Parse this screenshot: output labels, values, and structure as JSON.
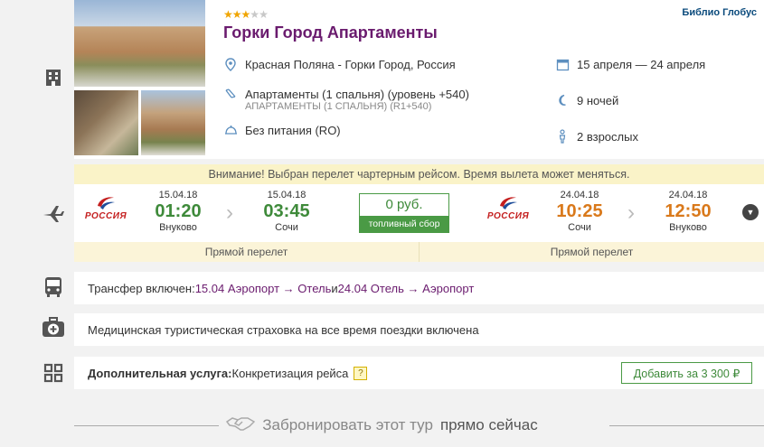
{
  "hotel": {
    "stars_total": 5,
    "stars_filled": 3,
    "operator": "Библио Глобус",
    "name": "Горки Город Апартаменты",
    "location": "Красная Поляна - Горки Город, Россия",
    "room": "Апартаменты (1 спальня) (уровень +540)",
    "room_sub": "АПАРТАМЕНТЫ (1 СПАЛЬНЯ) (R1+540)",
    "meal": "Без питания (RO)",
    "dates": "15 апреля — 24 апреля",
    "nights": "9 ночей",
    "guests": "2 взрослых"
  },
  "flight": {
    "notice": "Внимание! Выбран перелет чартерным рейсом. Время вылета может меняться.",
    "airline": "РОССИЯ",
    "outbound": {
      "dep_date": "15.04.18",
      "dep_time": "01:20",
      "dep_airport": "Внуково",
      "arr_date": "15.04.18",
      "arr_time": "03:45",
      "arr_airport": "Сочи",
      "type": "Прямой перелет"
    },
    "fuel": {
      "amount": "0 руб.",
      "label": "топливный сбор"
    },
    "inbound": {
      "dep_date": "24.04.18",
      "dep_time": "10:25",
      "dep_airport": "Сочи",
      "arr_date": "24.04.18",
      "arr_time": "12:50",
      "arr_airport": "Внуково",
      "type": "Прямой перелет"
    }
  },
  "transfer": {
    "prefix": "Трансфер включен: ",
    "leg1": "15.04 Аэропорт → Отель",
    "conj": " и ",
    "leg2": "24.04 Отель → Аэропорт"
  },
  "insurance": {
    "text": "Медицинская туристическая страховка на все время поездки включена"
  },
  "extra": {
    "label": "Дополнительная услуга:",
    "value": " Конкретизация рейса",
    "help": "?",
    "button": "Добавить за 3 300 ₽"
  },
  "footer": {
    "cta_main": "Забронировать этот тур",
    "cta_bold": "прямо сейчас"
  },
  "icons": [
    "hotel-icon",
    "plane-icon",
    "bus-icon",
    "medkit-icon",
    "grid-icon",
    "map-pin-icon",
    "bed-icon",
    "meal-icon",
    "calendar-icon",
    "moon-icon",
    "person-icon",
    "handshake-icon",
    "chevron-right-icon",
    "chevron-down-icon"
  ],
  "colors": {
    "accent": "#6a1b6e",
    "green": "#3e8a3a",
    "orange": "#d9791b",
    "notice_bg": "#faf3c8"
  }
}
